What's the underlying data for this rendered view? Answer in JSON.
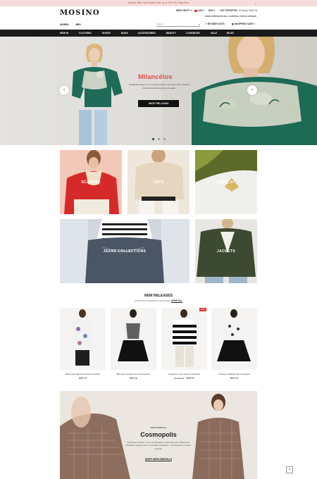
{
  "promo_bar": {
    "text": "Special Offer: Mid Season Sale up to 70% Off. Shop Now",
    "close": "×"
  },
  "header": {
    "logo": "MOSINO",
    "need_help": "NEED HELP? ▾",
    "currency": "USD ▾",
    "language": "ENG ▾",
    "gift_registry": "GIFT REGISTRY",
    "account": "Hi Guest, SIGN IN",
    "free_shipping": "FREE INTERNATIONAL SHIPPING FOR $5 ORDERS",
    "women_tab": "WOMEN",
    "men_tab": "MEN",
    "search_placeholder": "Search",
    "wishlists": "MY WISH LISTS",
    "cart": "SHOPPING CART ▾"
  },
  "nav": {
    "items": [
      "NEW IN",
      "CLOTHING",
      "SHOES",
      "BAGS",
      "ACCESSORIES",
      "BEAUTY",
      "LOOKBOOK",
      "SALE",
      "BLOG"
    ]
  },
  "hero": {
    "title": "Milancélos",
    "text": "Vestibulum laoreet mi non porta ipsique commodo ante. Invenica pharetra suscipit lacus ac convallis.",
    "button": "SHOP THE LOOKS",
    "prev": "‹",
    "next": "›",
    "slides": 3,
    "active_slide": 1
  },
  "categories": [
    {
      "label": "SCARVES"
    },
    {
      "label": "TOPS"
    },
    {
      "label": "JEWELRY"
    },
    {
      "label": "JEANS COLLECTIONS"
    },
    {
      "label": "JACKETS"
    }
  ],
  "new_releases": {
    "title": "NEW RELEASES",
    "subtitle": "Aenean ibus tincidunt du consequat.",
    "shop_all": "SHOP ALL",
    "products": [
      {
        "name": "Maecenas elementum lacus tincidunt",
        "old_price": "",
        "price": "$380.00",
        "sale": ""
      },
      {
        "name": "Bibendum pretium ac condimentum",
        "old_price": "",
        "price": "$960.00",
        "sale": ""
      },
      {
        "name": "Feugiat ac arcu tempor imperdiet",
        "old_price": "$1,190.00",
        "price": "$589.00",
        "sale": "Sale"
      },
      {
        "name": "Interdum nullaque iaet consequat",
        "old_price": "",
        "price": "$690.00",
        "sale": ""
      }
    ]
  },
  "promo_banner": {
    "small": "NEW ARRIVALS",
    "title": "Cosmopolis",
    "text": "Vestibulum laoreet mi non porta ipsique commodo ante. Maecenas. Phasellus suscipit arcu ut convallis vestibulum. Ut ad laoreet, posuere gravida.",
    "link": "SHOP NEW ARRIVALS"
  },
  "back_to_top": "^",
  "colors": {
    "accent": "#d9534f",
    "nav_bg": "#1a1a1a",
    "promo_bg": "#f6dcdc"
  }
}
